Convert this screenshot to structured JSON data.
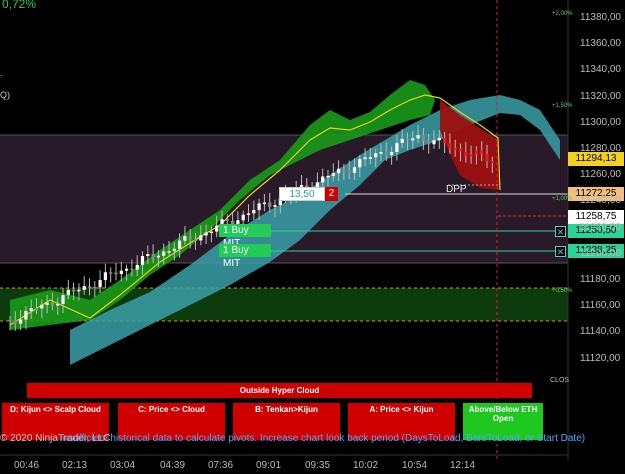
{
  "header": {
    "change_pct": "0,72%"
  },
  "side_marks": [
    ".",
    "Q)"
  ],
  "orders": {
    "qty_box": "13,50",
    "count_badge": "2",
    "buy1": "1  Buy MIT",
    "buy2": "1  Buy MIT",
    "dpp_label": "DPP"
  },
  "price_tags": {
    "t1": "11294,13",
    "t2": "11272,25",
    "t3": "11258,75",
    "t4": "11250,50",
    "t5": "11238,25"
  },
  "cloud_banner": "Outside Hyper Cloud",
  "signal_buttons": [
    {
      "label": "D: Kijun <> Scalp Cloud",
      "color": "#d10000"
    },
    {
      "label": "C: Price <> Cloud",
      "color": "#d10000"
    },
    {
      "label": "B: Tenkan>Kijun",
      "color": "#d10000"
    },
    {
      "label": "A: Price <> Kijun",
      "color": "#d10000"
    },
    {
      "label": "Above/Below ETH Open",
      "color": "#1ec81e"
    }
  ],
  "notice": {
    "copyright": "© 2020 NinjaTrader, LLC",
    "message": "Insufficient historical data to calculate pivots. Increase chart look back period (DaysToLoad, BarsToLoad, or Start Date)"
  },
  "pct_labels": [
    "+2,00%",
    "+1,50%",
    "+1,00%",
    "+0,50%"
  ],
  "clos_label": "CLOS",
  "y_axis": [
    "11380,00",
    "11360,00",
    "11340,00",
    "11320,00",
    "11300,00",
    "11280,00",
    "11260,00",
    "11240,00",
    "11220,00",
    "11200,00",
    "11180,00",
    "11160,00",
    "11140,00",
    "11120,00"
  ],
  "x_axis": [
    "00:46",
    "02:13",
    "03:04",
    "04:39",
    "07:36",
    "09:01",
    "09:35",
    "10:02",
    "10:54",
    "12:14"
  ],
  "colors": {
    "bull_cloud": "#1a9a1a",
    "bear_cloud": "#9c1010",
    "ichimoku_cloud": "#3aa0a8",
    "zone_purple": "#2a1a2a",
    "zone_green": "#0a3a0a",
    "buy_order": "#22cc55",
    "tag_yellow": "#f2d21a"
  }
}
